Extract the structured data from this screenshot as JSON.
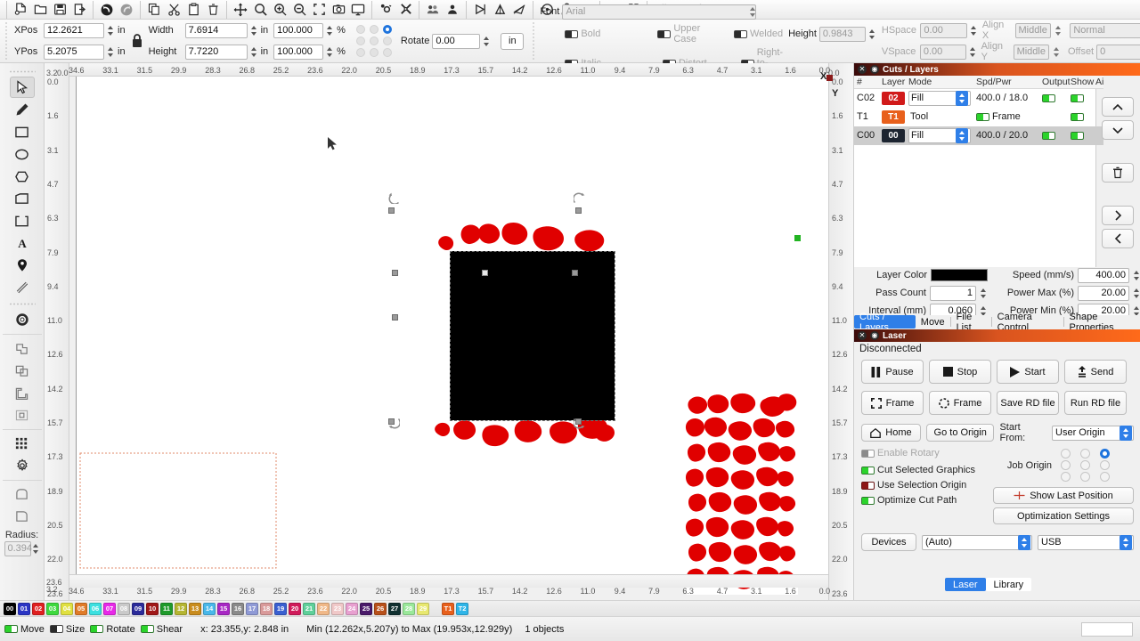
{
  "toolbar": {
    "icons": [
      "new-file-icon",
      "open-folder-icon",
      "save-icon",
      "export-icon",
      "undo-icon",
      "redo-icon",
      "duplicate-icon",
      "cut-icon",
      "paste-icon",
      "delete-icon",
      "move-icon",
      "zoom-fit-icon",
      "zoom-in-icon",
      "zoom-out-icon",
      "zoom-selection-icon",
      "frame-camera-icon",
      "preview-icon",
      "settings-icon",
      "device-settings-icon",
      "group-icon",
      "ungroup-icon",
      "flip-horizontal-icon",
      "flip-vertical-icon",
      "close-path-icon",
      "center-icon",
      "weld-icon",
      "boolean-icon",
      "align-left-icon",
      "align-center-icon",
      "distribute-icon",
      "node-edit-icon",
      "offset-icon"
    ],
    "overflow_label": "»"
  },
  "properties": {
    "xpos_label": "XPos",
    "xpos_value": "12.2621",
    "ypos_label": "YPos",
    "ypos_value": "5.2075",
    "unit": "in",
    "width_label": "Width",
    "width_value": "7.6914",
    "height_label": "Height",
    "height_value": "7.7220",
    "scale_w_value": "100.000",
    "scale_h_value": "100.000",
    "percent": "%",
    "lock_icon": "padlock-icon",
    "rotate_label": "Rotate",
    "rotate_value": "0.00",
    "unit_button": "in",
    "anchor_selected_index": 2,
    "font_label": "Font",
    "font_value": "Arial",
    "text_height_label": "Height",
    "text_height_value": "0.9843",
    "hspace_label": "HSpace",
    "hspace_value": "0.00",
    "vspace_label": "VSpace",
    "vspace_value": "0.00",
    "alignx_label": "Align X",
    "alignx_value": "Middle",
    "aligny_label": "Align Y",
    "aligny_value": "Middle",
    "style_value": "Normal",
    "offset_label": "Offset",
    "offset_value": "0",
    "checks": [
      {
        "label": "Bold"
      },
      {
        "label": "Italic"
      },
      {
        "label": "Upper Case"
      },
      {
        "label": "Distort"
      },
      {
        "label": "Welded"
      },
      {
        "label": "Right-to-Left"
      }
    ]
  },
  "left_tools": {
    "items": [
      {
        "name": "select-tool",
        "active": true
      },
      {
        "name": "pen-tool",
        "active": false
      },
      {
        "name": "rectangle-tool",
        "active": false
      },
      {
        "name": "ellipse-tool",
        "active": false
      },
      {
        "name": "polygon-tool",
        "active": false
      },
      {
        "name": "shape-tool",
        "active": false
      },
      {
        "name": "bracket-tool",
        "active": false
      },
      {
        "name": "text-tool",
        "active": false
      },
      {
        "name": "position-marker-tool",
        "active": false
      },
      {
        "name": "measure-tool",
        "active": false
      },
      {
        "name": "node-edit-tool",
        "active": false
      },
      {
        "name": "boolean-union-tool",
        "active": false
      },
      {
        "name": "boolean-subtract-tool",
        "active": false
      },
      {
        "name": "boolean-intersect-tool",
        "active": false
      },
      {
        "name": "boolean-exclude-tool",
        "active": false
      },
      {
        "name": "array-tool",
        "active": false
      },
      {
        "name": "gear-tool",
        "active": false
      },
      {
        "name": "fillet-round-tool",
        "active": false
      },
      {
        "name": "fillet-corner-tool",
        "active": false
      }
    ],
    "radius_label": "Radius:",
    "radius_value": "0.394"
  },
  "canvas": {
    "ruler_top": [
      "34.6",
      "33.1",
      "31.5",
      "29.9",
      "28.3",
      "26.8",
      "25.2",
      "23.6",
      "22.0",
      "20.5",
      "18.9",
      "17.3",
      "15.7",
      "14.2",
      "12.6",
      "11.0",
      "9.4",
      "7.9",
      "6.3",
      "4.7",
      "3.1",
      "1.6",
      "0.0"
    ],
    "ruler_left": [
      "0.0",
      "1.6",
      "3.1",
      "4.7",
      "6.3",
      "7.9",
      "9.4",
      "11.0",
      "12.6",
      "14.2",
      "15.7",
      "17.3",
      "18.9",
      "20.5",
      "22.0",
      "23.6"
    ],
    "corner_left": "3.2",
    "corner_origin": "0.0",
    "axis_x_label": "X",
    "axis_y_label": "Y",
    "origin_marker": "origin-marker"
  },
  "cuts_panel": {
    "title": "Cuts / Layers",
    "close_icon": "close-icon",
    "float_icon": "float-icon",
    "columns": [
      "#",
      "Layer",
      "Mode",
      "Spd/Pwr",
      "Output",
      "Show",
      "Ai"
    ],
    "rows": [
      {
        "id": "C02",
        "layer": "02",
        "color": "#d11a1a",
        "mode": "Fill",
        "spdpwr": "400.0 / 18.0",
        "output": true,
        "show": true,
        "selected": false,
        "is_tool": false
      },
      {
        "id": "T1",
        "layer": "T1",
        "color": "#e8601c",
        "mode": "Tool",
        "spdpwr": "Frame",
        "output": true,
        "show": true,
        "selected": false,
        "is_tool": true
      },
      {
        "id": "C00",
        "layer": "00",
        "color": "#1c2430",
        "mode": "Fill",
        "spdpwr": "400.0 / 20.0",
        "output": true,
        "show": true,
        "selected": true,
        "is_tool": false
      }
    ],
    "side_buttons": [
      "move-up-button",
      "move-down-button",
      "delete-layer-button",
      "next-button",
      "prev-button"
    ],
    "layer_color_label": "Layer Color",
    "layer_color_value": "#000000",
    "speed_label": "Speed (mm/s)",
    "speed_value": "400.00",
    "pass_count_label": "Pass Count",
    "pass_count_value": "1",
    "power_max_label": "Power Max (%)",
    "power_max_value": "20.00",
    "interval_label": "Interval (mm)",
    "interval_value": "0.060",
    "power_min_label": "Power Min (%)",
    "power_min_value": "20.00",
    "tabs": [
      {
        "label": "Cuts / Layers",
        "selected": true
      },
      {
        "label": "Move",
        "selected": false
      },
      {
        "label": "File List",
        "selected": false
      },
      {
        "label": "Camera Control",
        "selected": false
      },
      {
        "label": "Shape Properties",
        "selected": false
      }
    ]
  },
  "laser_panel": {
    "title": "Laser",
    "status": "Disconnected",
    "buttons_row1": [
      {
        "label": "Pause",
        "icon": "pause-icon"
      },
      {
        "label": "Stop",
        "icon": "stop-icon"
      },
      {
        "label": "Start",
        "icon": "play-icon"
      },
      {
        "label": "Send",
        "icon": "send-icon"
      }
    ],
    "buttons_row2": [
      {
        "label": "Frame",
        "icon": "frame-square-icon"
      },
      {
        "label": "Frame",
        "icon": "frame-round-icon"
      },
      {
        "label": "Save RD file",
        "icon": ""
      },
      {
        "label": "Run RD file",
        "icon": ""
      }
    ],
    "home_label": "Home",
    "home_icon": "home-icon",
    "go_to_origin_label": "Go to Origin",
    "start_from_label": "Start From:",
    "start_from_value": "User Origin",
    "enable_rotary_label": "Enable Rotary",
    "job_origin_label": "Job Origin",
    "job_origin_selected_index": 2,
    "cut_selected_label": "Cut Selected Graphics",
    "use_selection_origin_label": "Use Selection Origin",
    "optimize_label": "Optimize Cut Path",
    "show_last_position_label": "Show Last Position",
    "show_last_position_icon": "crosshair-icon",
    "optimization_settings_label": "Optimization Settings",
    "devices_label": "Devices",
    "device_value": "(Auto)",
    "connection_value": "USB",
    "bottom_tabs": [
      {
        "label": "Laser",
        "selected": true
      },
      {
        "label": "Library",
        "selected": false
      }
    ]
  },
  "palette": {
    "colors": [
      {
        "id": "00",
        "hex": "#000000"
      },
      {
        "id": "01",
        "hex": "#2b35c4"
      },
      {
        "id": "02",
        "hex": "#e02020"
      },
      {
        "id": "03",
        "hex": "#3ed93e"
      },
      {
        "id": "04",
        "hex": "#e0e040"
      },
      {
        "id": "05",
        "hex": "#e07b28"
      },
      {
        "id": "06",
        "hex": "#3ce0e0"
      },
      {
        "id": "07",
        "hex": "#e828e8"
      },
      {
        "id": "08",
        "hex": "#c9c9c9"
      },
      {
        "id": "09",
        "hex": "#2b2b9a"
      },
      {
        "id": "10",
        "hex": "#a01818"
      },
      {
        "id": "11",
        "hex": "#1f9a2b"
      },
      {
        "id": "12",
        "hex": "#b5b532"
      },
      {
        "id": "13",
        "hex": "#c98c1e"
      },
      {
        "id": "14",
        "hex": "#49b8ea"
      },
      {
        "id": "15",
        "hex": "#a828c4"
      },
      {
        "id": "16",
        "hex": "#8a8a8a"
      },
      {
        "id": "17",
        "hex": "#8f9ad6"
      },
      {
        "id": "18",
        "hex": "#d99a9a"
      },
      {
        "id": "19",
        "hex": "#3a5fd0"
      },
      {
        "id": "20",
        "hex": "#d01a5a"
      },
      {
        "id": "21",
        "hex": "#5fd09a"
      },
      {
        "id": "22",
        "hex": "#f0b888"
      },
      {
        "id": "23",
        "hex": "#f0c8c8"
      },
      {
        "id": "24",
        "hex": "#e8a0d0"
      },
      {
        "id": "25",
        "hex": "#4a1a6a"
      },
      {
        "id": "26",
        "hex": "#b8501a"
      },
      {
        "id": "27",
        "hex": "#103030"
      },
      {
        "id": "28",
        "hex": "#9ae89a"
      },
      {
        "id": "29",
        "hex": "#e8e870"
      }
    ],
    "tools": [
      {
        "id": "T1",
        "hex": "#e8601c"
      },
      {
        "id": "T2",
        "hex": "#2fb5e8"
      }
    ]
  },
  "statusbar": {
    "toggles": [
      {
        "label": "Move",
        "on": true
      },
      {
        "label": "Size",
        "on": false
      },
      {
        "label": "Rotate",
        "on": true
      },
      {
        "label": "Shear",
        "on": true
      }
    ],
    "cursor": "x: 23.355,y: 2.848 in",
    "bounds": "Min (12.262x,5.207y) to Max (19.953x,12.929y)",
    "objects": "1 objects"
  }
}
